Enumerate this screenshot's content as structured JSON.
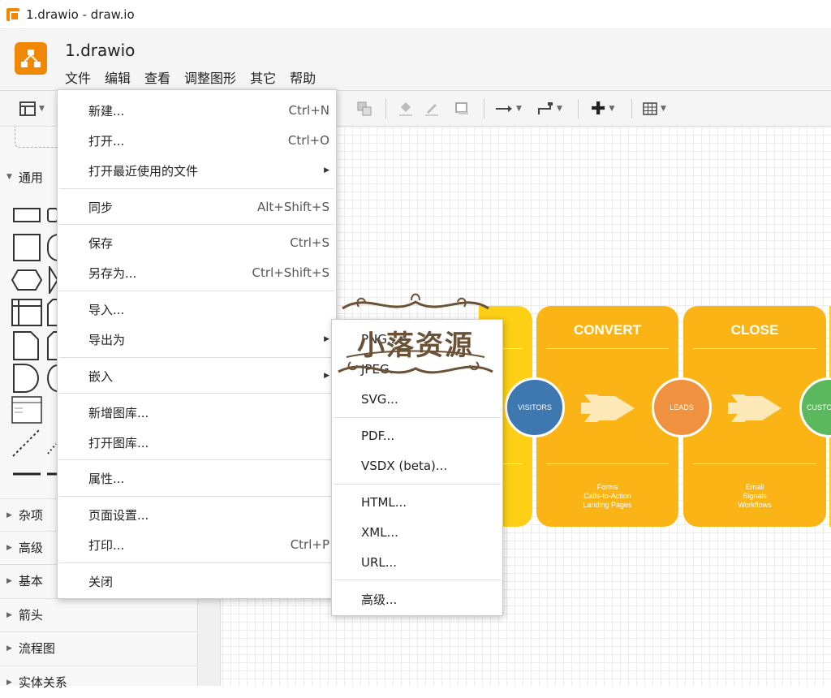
{
  "window": {
    "title": "1.drawio - draw.io"
  },
  "header": {
    "doc_title": "1.drawio"
  },
  "menubar": [
    "文件",
    "编辑",
    "查看",
    "调整图形",
    "其它",
    "帮助"
  ],
  "sidebar": {
    "categories": [
      "通用",
      "杂项",
      "高级",
      "基本",
      "箭头",
      "流程图",
      "实体关系"
    ]
  },
  "file_menu": {
    "items": [
      {
        "label": "新建...",
        "shortcut": "Ctrl+N"
      },
      {
        "label": "打开...",
        "shortcut": "Ctrl+O"
      },
      {
        "label": "打开最近使用的文件",
        "submenu": true
      },
      {
        "label": "同步",
        "shortcut": "Alt+Shift+S"
      },
      {
        "label": "保存",
        "shortcut": "Ctrl+S"
      },
      {
        "label": "另存为...",
        "shortcut": "Ctrl+Shift+S"
      },
      {
        "label": "导入..."
      },
      {
        "label": "导出为",
        "submenu": true
      },
      {
        "label": "嵌入",
        "submenu": true
      },
      {
        "label": "新增图库..."
      },
      {
        "label": "打开图库..."
      },
      {
        "label": "属性..."
      },
      {
        "label": "页面设置..."
      },
      {
        "label": "打印...",
        "shortcut": "Ctrl+P"
      },
      {
        "label": "关闭"
      }
    ]
  },
  "export_menu": {
    "items": [
      "PNG...",
      "JPEG...",
      "SVG...",
      "PDF...",
      "VSDX (beta)...",
      "HTML...",
      "XML...",
      "URL...",
      "高级..."
    ]
  },
  "diagram": {
    "cards": [
      {
        "title": "CONVERT",
        "subtitle": "Forms\nCalls-to-Action\nLanding Pages",
        "color": "#fbb415"
      },
      {
        "title": "CLOSE",
        "subtitle": "Email\nSignals\nWorkflows",
        "color": "#fbb415"
      }
    ],
    "bubbles": [
      {
        "label": "VISITORS",
        "color": "#3f77b0"
      },
      {
        "label": "LEADS",
        "color": "#f0913f"
      },
      {
        "label": "CUSTO",
        "color": "#5cb85c"
      }
    ]
  },
  "watermark": {
    "text": "小落资源"
  },
  "colors": {
    "accent": "#f08705",
    "card": "#fbb415",
    "card_left": "#fdd016"
  }
}
